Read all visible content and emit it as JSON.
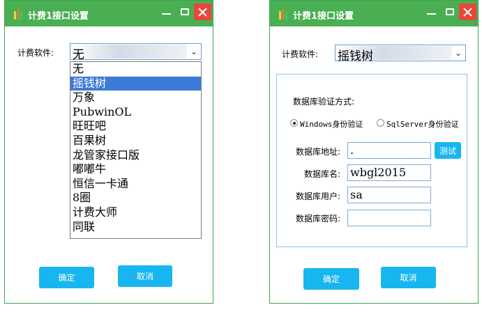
{
  "left_window": {
    "title": "计费1接口设置",
    "software_label": "计费软件:",
    "selected_value": "无",
    "dropdown_items": [
      "无",
      "摇钱树",
      "万象",
      "PubwinOL",
      "旺旺吧",
      "百果树",
      "龙管家接口版",
      "嘟嘟牛",
      "恒信一卡通",
      "8圈",
      "计费大师",
      "同联"
    ],
    "highlighted_index": 1,
    "ok_label": "确定",
    "cancel_label": "取消"
  },
  "right_window": {
    "title": "计费1接口设置",
    "software_label": "计费软件:",
    "selected_value": "摇钱树",
    "auth_heading": "数据库验证方式:",
    "radio_windows": "Windows身份验证",
    "radio_sqlserver": "SqlServer身份验证",
    "selected_auth": "windows",
    "fields": {
      "address_label": "数据库地址:",
      "address_value": ".",
      "name_label": "数据库名:",
      "name_value": "wbgl2015",
      "user_label": "数据库用户:",
      "user_value": "sa",
      "password_label": "数据库密码:",
      "password_value": ""
    },
    "test_label": "测试",
    "ok_label": "确定",
    "cancel_label": "取消"
  },
  "colors": {
    "titlebar": "#4aaf53",
    "close": "#e8473c",
    "button": "#17b6f0",
    "selection": "#3e7ad8"
  }
}
